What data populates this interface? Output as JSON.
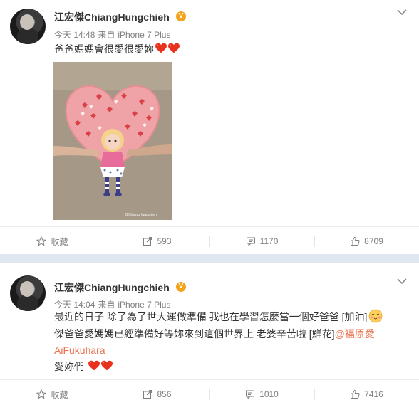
{
  "posts": [
    {
      "author": "江宏傑ChiangHungchieh",
      "verified_badge": "V",
      "time": "今天 14:48",
      "source_prefix": "来自",
      "source": "iPhone 7 Plus",
      "text_lines": [
        "爸爸媽媽會很愛很愛妳"
      ],
      "photo_watermark": "@ChiangHungchieh",
      "actions": {
        "favorite": "收藏",
        "repost": "593",
        "comment": "1170",
        "like": "8709"
      }
    },
    {
      "author": "江宏傑ChiangHungchieh",
      "verified_badge": "V",
      "time": "今天 14:04",
      "source_prefix": "来自",
      "source": "iPhone 7 Plus",
      "text_lines": [
        "最近的日子 除了為了世大運做準備 我也在學習怎麼當一個好爸爸 [加油]",
        "傑爸爸愛媽媽已經準備好等妳來到這個世界上  老婆辛苦啦 [鮮花]",
        "愛妳們"
      ],
      "mention_a": "@福原愛",
      "mention_b": "AiFukuhara",
      "actions": {
        "favorite": "收藏",
        "repost": "856",
        "comment": "1010",
        "like": "7416"
      }
    }
  ],
  "colors": {
    "accent": "#eb7350",
    "badge": "#f2a41b",
    "separator": "#dfe8f1",
    "heart": "#e8321e"
  },
  "icons": [
    "chevron-down-icon",
    "verified-icon",
    "heart-emoji-icon",
    "star-icon",
    "repost-icon",
    "comment-icon",
    "like-icon",
    "blush-emoji-icon"
  ]
}
